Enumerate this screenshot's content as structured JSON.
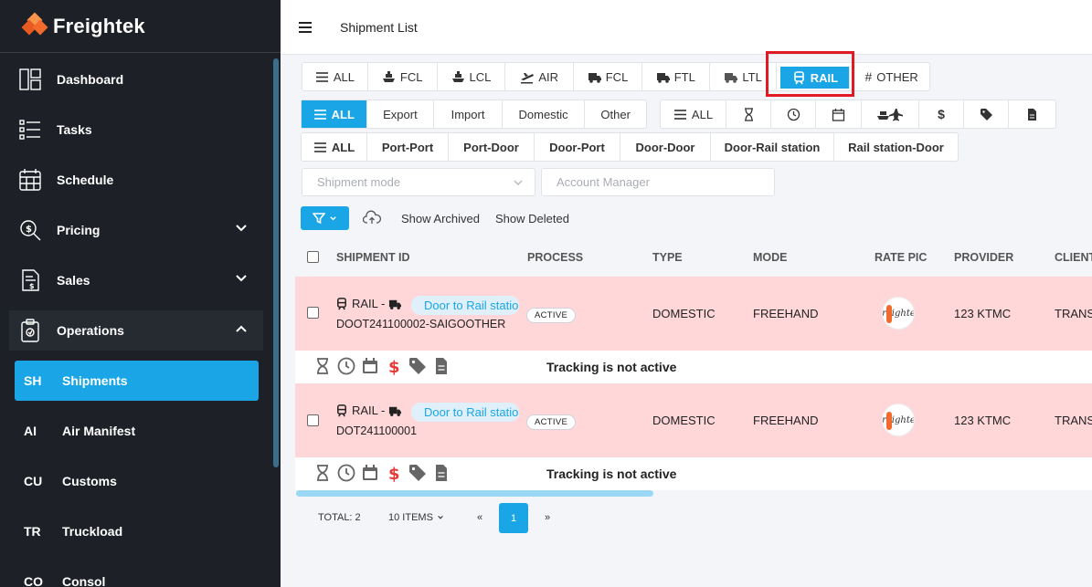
{
  "app": {
    "brand": "Freightek"
  },
  "sidebar": {
    "items": [
      {
        "label": "Dashboard",
        "icon": "dashboard-icon"
      },
      {
        "label": "Tasks",
        "icon": "tasks-icon"
      },
      {
        "label": "Schedule",
        "icon": "calendar-icon"
      },
      {
        "label": "Pricing",
        "icon": "pricing-icon",
        "expandable": true
      },
      {
        "label": "Sales",
        "icon": "sales-icon",
        "expandable": true
      },
      {
        "label": "Operations",
        "icon": "clipboard-icon",
        "expanded": true
      }
    ],
    "sub_items": [
      {
        "abbr": "SH",
        "label": "Shipments",
        "selected": true
      },
      {
        "abbr": "AI",
        "label": "Air Manifest"
      },
      {
        "abbr": "CU",
        "label": "Customs"
      },
      {
        "abbr": "TR",
        "label": "Truckload"
      },
      {
        "abbr": "CO",
        "label": "Consol"
      }
    ]
  },
  "header": {
    "title": "Shipment List"
  },
  "transport_tabs": {
    "items": [
      "ALL",
      "FCL",
      "LCL",
      "AIR",
      "FCL",
      "FTL",
      "LTL",
      "RAIL",
      "OTHER"
    ],
    "selected": "RAIL"
  },
  "direction_tabs": {
    "items": [
      "ALL",
      "Export",
      "Import",
      "Domestic",
      "Other"
    ],
    "selected": "ALL"
  },
  "status_tabs": {
    "items": [
      "ALL",
      "hourglass-icon",
      "clock-icon",
      "calendar-icon",
      "ship-plane-icon",
      "dollar-icon",
      "tag-icon",
      "document-icon"
    ],
    "selected": "ALL"
  },
  "route_tabs": {
    "items": [
      "ALL",
      "Port-Port",
      "Port-Door",
      "Door-Port",
      "Door-Door",
      "Door-Rail station",
      "Rail station-Door"
    ],
    "selected": "ALL"
  },
  "filters": {
    "shipment_mode_placeholder": "Shipment mode",
    "account_manager_placeholder": "Account Manager",
    "show_archived": "Show Archived",
    "show_deleted": "Show Deleted"
  },
  "table": {
    "columns": [
      "SHIPMENT ID",
      "PROCESS",
      "TYPE",
      "MODE",
      "RATE PIC",
      "PROVIDER",
      "CLIENT"
    ],
    "rows": [
      {
        "mode_label": "RAIL -",
        "route_tag": "Door to Rail station",
        "shipment_id": "DOOT241100002-SAIGOOTHER",
        "process": "ACTIVE",
        "type": "DOMESTIC",
        "mode": "FREEHAND",
        "rate_pic": "Freightek",
        "provider": "123 KTMC",
        "client": "TRANS",
        "tracking": "Tracking is not active"
      },
      {
        "mode_label": "RAIL -",
        "route_tag": "Door to Rail station",
        "shipment_id": "DOT241100001",
        "process": "ACTIVE",
        "type": "DOMESTIC",
        "mode": "FREEHAND",
        "rate_pic": "Freightek",
        "provider": "123 KTMC",
        "client": "TRANS",
        "tracking": "Tracking is not active"
      }
    ]
  },
  "pagination": {
    "total": "TOTAL: 2",
    "page_size": "10 ITEMS",
    "prev": "«",
    "current": "1",
    "next": "»"
  },
  "colors": {
    "accent": "#1aa6e6",
    "sidebar": "#1d2026",
    "row_highlight": "#ffd7d9",
    "annotation": "#e01b24"
  }
}
